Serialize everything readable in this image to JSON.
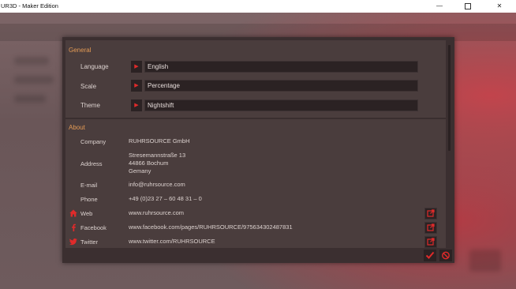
{
  "window": {
    "title": "UR3D - Maker Edition",
    "min_glyph": "—",
    "close_glyph": "✕"
  },
  "settings": {
    "general": {
      "heading": "General",
      "rows": [
        {
          "label": "Language",
          "value": "English",
          "arrow_icon": "play-arrow-icon"
        },
        {
          "label": "Scale",
          "value": "Percentage",
          "arrow_icon": "play-arrow-icon"
        },
        {
          "label": "Theme",
          "value": "Nightshift",
          "arrow_icon": "play-arrow-icon"
        }
      ]
    },
    "about": {
      "heading": "About",
      "company_label": "Company",
      "company": "RUHRSOURCE GmbH",
      "address_label": "Address",
      "address_line1": "Stresemannstraße 13",
      "address_line2": "44866 Bochum",
      "address_line3": "Gemany",
      "email_label": "E-mail",
      "email": "info@ruhrsource.com",
      "phone_label": "Phone",
      "phone": "+49 (0)23 27 – 60 48 31 – 0",
      "web_label": "Web",
      "web": "www.ruhrsource.com",
      "facebook_label": "Facebook",
      "facebook": "www.facebook.com/pages/RUHRSOURCE/975634302487831",
      "twitter_label": "Twitter",
      "twitter": "www.twitter.com/RUHRSOURCE"
    }
  },
  "colors": {
    "accent_red": "#e02a2a",
    "section_heading": "#e39a55",
    "dialog_bg": "#4a3d3d"
  }
}
